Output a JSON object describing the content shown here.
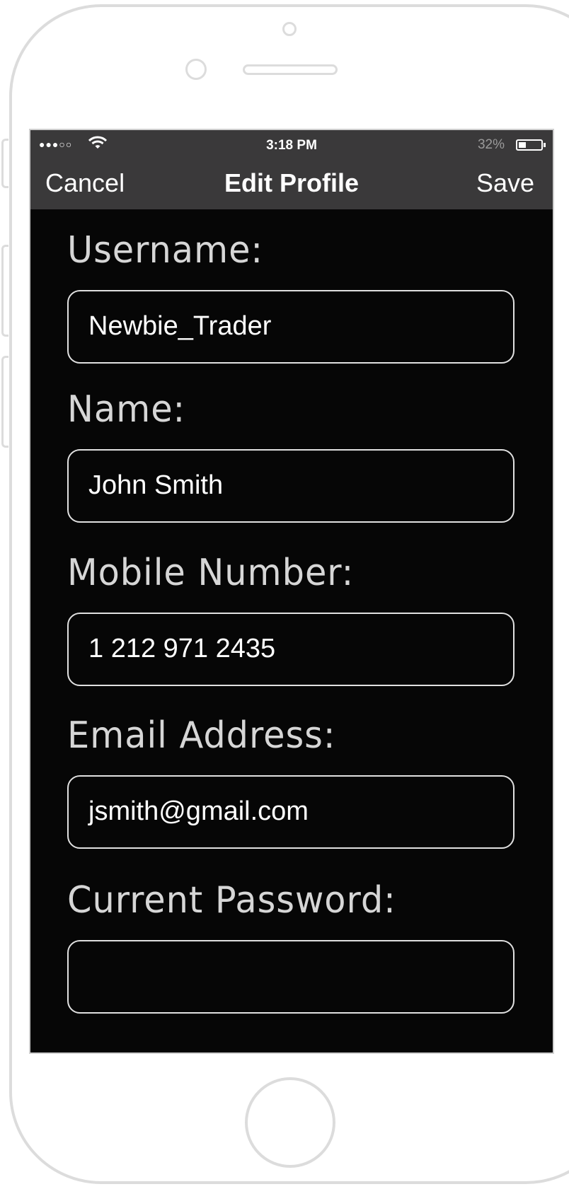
{
  "status_bar": {
    "signal": "●●●○○",
    "time": "3:18 PM",
    "battery_percent_text": "32%",
    "battery_level": 0.32
  },
  "nav": {
    "cancel_label": "Cancel",
    "title": "Edit Profile",
    "save_label": "Save"
  },
  "form": {
    "username_label": "Username:",
    "username_value": "Newbie_Trader",
    "name_label": "Name:",
    "name_value": "John Smith",
    "mobile_label": "Mobile Number:",
    "mobile_value": "1 212 971 2435",
    "email_label": "Email Address:",
    "email_value": "jsmith@gmail.com",
    "password_label": "Current Password:",
    "password_value": ""
  },
  "colors": {
    "screen_bg": "#060606",
    "bar_bg": "#3a393a",
    "frame": "#dcdcdc"
  }
}
